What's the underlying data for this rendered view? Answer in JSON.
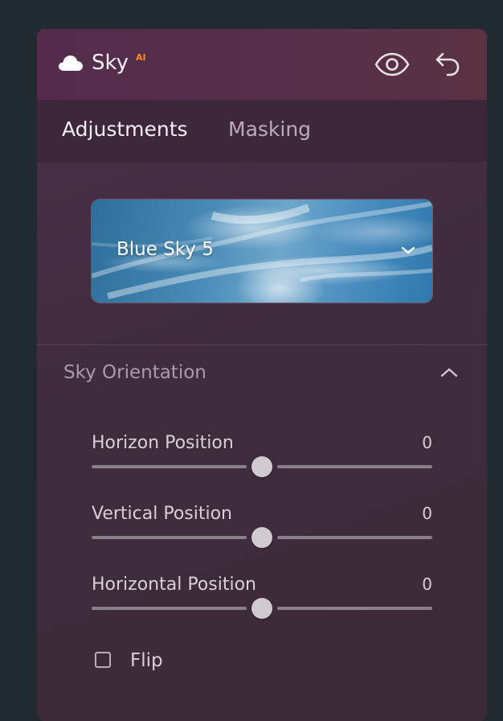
{
  "header": {
    "title": "Sky",
    "badge": "AI",
    "icons": [
      "cloud-icon",
      "eye-icon",
      "undo-icon"
    ],
    "badge_color": "#ff8a1f"
  },
  "tabs": [
    {
      "label": "Adjustments",
      "active": true
    },
    {
      "label": "Masking",
      "active": false
    }
  ],
  "sky_select": {
    "value": "Blue Sky 5",
    "icon": "chevron-down-icon"
  },
  "section": {
    "title": "Sky Orientation",
    "expanded": true,
    "icon": "chevron-up-icon"
  },
  "sliders": [
    {
      "label": "Horizon Position",
      "value": "0",
      "fraction": 0.5
    },
    {
      "label": "Vertical Position",
      "value": "0",
      "fraction": 0.5
    },
    {
      "label": "Horizontal Position",
      "value": "0",
      "fraction": 0.5
    }
  ],
  "flip": {
    "label": "Flip",
    "checked": false
  }
}
